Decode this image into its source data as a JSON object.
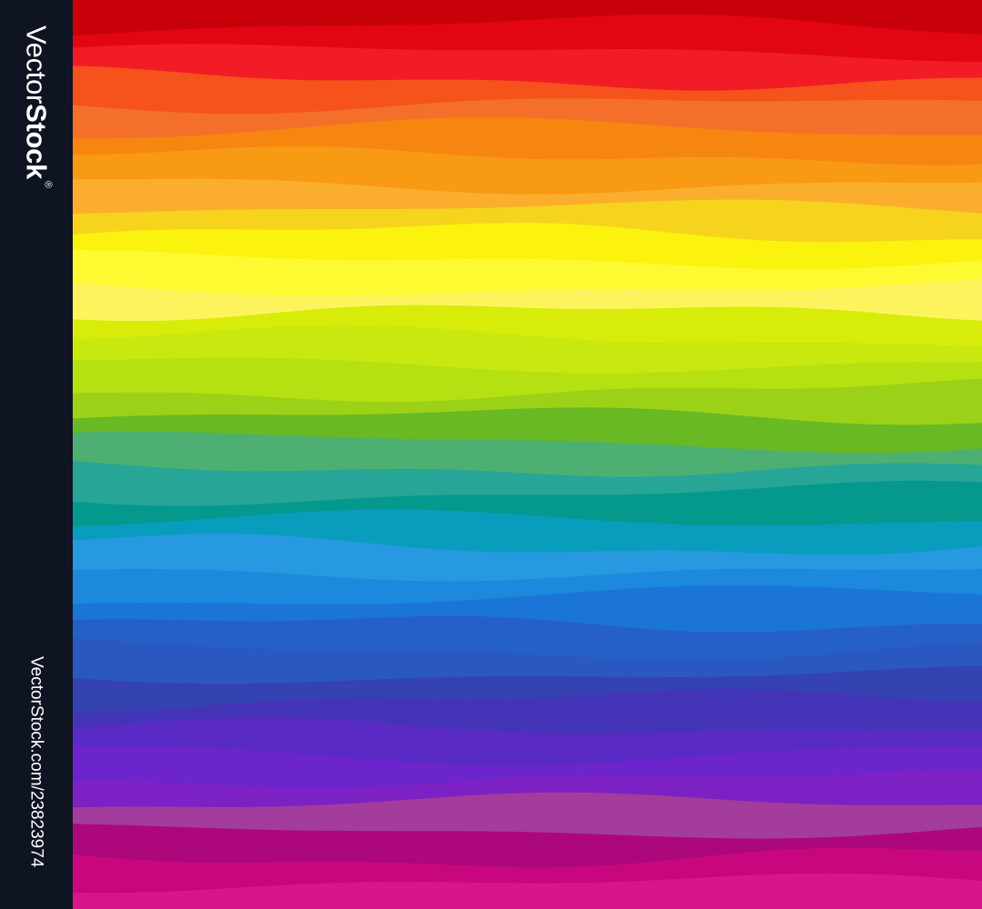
{
  "sidebar": {
    "brand_light": "Vector",
    "brand_bold": "Stock",
    "brand_reg": "®",
    "url": "VectorStock.com/23823974",
    "background": "#0f1422"
  },
  "artwork": {
    "style": "wavy horizontal rainbow stripes",
    "palette": [
      "#c8000a",
      "#e10612",
      "#f21c26",
      "#f5521c",
      "#f36f2a",
      "#f6860f",
      "#f89a14",
      "#fbae2e",
      "#f6d31d",
      "#fbf30e",
      "#fefa32",
      "#fdf45d",
      "#d8ec09",
      "#c8e80f",
      "#b5e012",
      "#9bd116",
      "#68b924",
      "#4db072",
      "#27a596",
      "#04998c",
      "#089dbd",
      "#2699e0",
      "#1c89dc",
      "#1b75d6",
      "#2560c8",
      "#2b57c1",
      "#3542b2",
      "#4434b8",
      "#5a2ac4",
      "#6c24cc",
      "#7c22c4",
      "#a43c9c",
      "#ac087b",
      "#c8077f",
      "#d7168c"
    ]
  }
}
